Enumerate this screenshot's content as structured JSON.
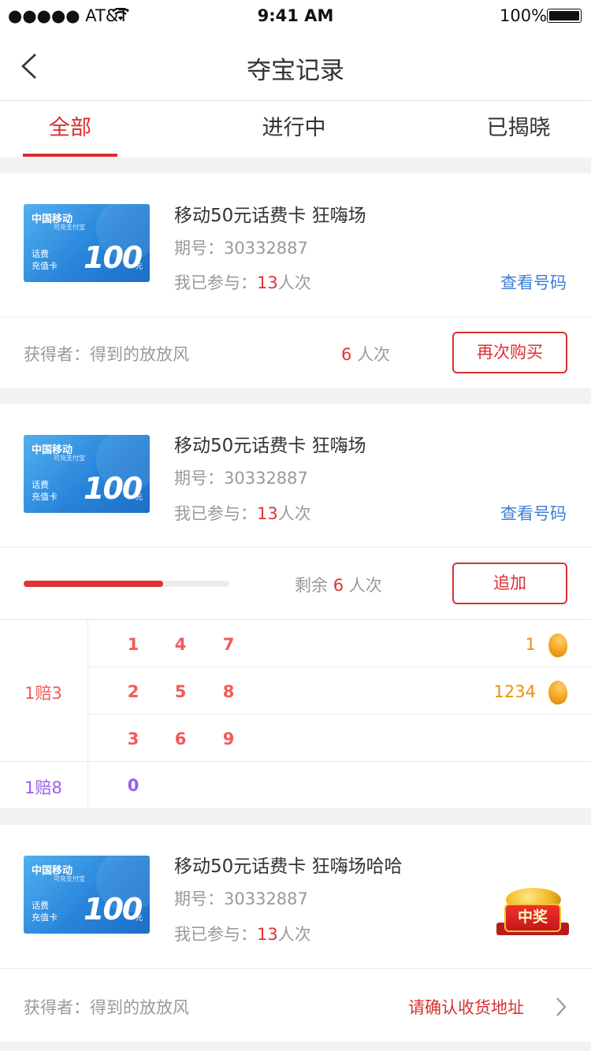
{
  "status_bar": {
    "carrier": "●●●●● AT&T",
    "time": "9:41 AM",
    "battery": "100%"
  },
  "nav": {
    "title": "夺宝记录",
    "back_icon": "chevron-left-icon"
  },
  "tabs": [
    {
      "label": "全部",
      "active": true
    },
    {
      "label": "进行中",
      "active": false
    },
    {
      "label": "已揭晓",
      "active": false
    }
  ],
  "thumb": {
    "brand": "中国移动",
    "sub": "可充支付宝",
    "label": "话费\n充值卡",
    "amount": "100",
    "unit": "元"
  },
  "records": [
    {
      "title": "移动50元话费卡 狂嗨场",
      "period_label": "期号：",
      "period": "30332887",
      "joined_label": "我已参与：",
      "joined_count": "13",
      "joined_unit": "人次",
      "view_codes": "查看号码",
      "winner_label": "获得者：",
      "winner": "得到的放放风",
      "winner_count": "6",
      "winner_unit": "人次",
      "action": "再次购买"
    },
    {
      "title": "移动50元话费卡 狂嗨场",
      "period_label": "期号：",
      "period": "30332887",
      "joined_label": "我已参与：",
      "joined_count": "13",
      "joined_unit": "人次",
      "view_codes": "查看号码",
      "remaining_label": "剩余",
      "remaining_count": "6",
      "remaining_unit": "人次",
      "progress": 0.68,
      "action": "追加",
      "grid": {
        "groups": [
          {
            "label": "1赔3",
            "color": "#f25a5a",
            "rows": [
              {
                "numbers": [
                  "1",
                  "4",
                  "7"
                ],
                "beans": "1"
              },
              {
                "numbers": [
                  "2",
                  "5",
                  "8"
                ],
                "beans": "1234"
              },
              {
                "numbers": [
                  "3",
                  "6",
                  "9"
                ],
                "beans": ""
              }
            ]
          },
          {
            "label": "1赔8",
            "color": "#9b5cf0",
            "rows": [
              {
                "numbers": [
                  "0"
                ],
                "beans": ""
              }
            ]
          }
        ]
      }
    },
    {
      "title": "移动50元话费卡 狂嗨场哈哈",
      "period_label": "期号：",
      "period": "30332887",
      "joined_label": "我已参与：",
      "joined_count": "13",
      "joined_unit": "人次",
      "badge": "中奖",
      "winner_label": "获得者：",
      "winner": "得到的放放风",
      "confirm_address": "请确认收货地址"
    }
  ],
  "colors": {
    "accent": "#d93030",
    "link": "#3a7fd9",
    "bean": "#e8920e",
    "odds_red": "#f25a5a",
    "odds_purple": "#9b5cf0"
  }
}
